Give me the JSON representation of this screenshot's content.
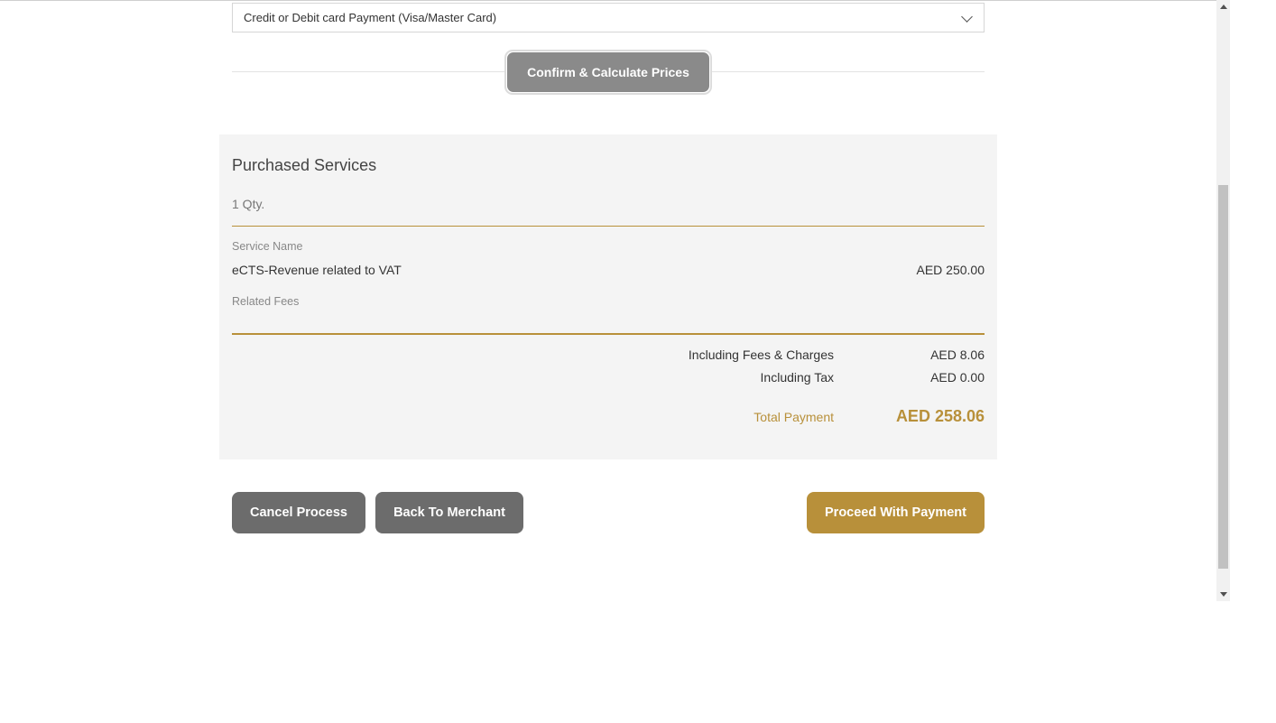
{
  "payment": {
    "selected_method": "Credit or Debit card Payment (Visa/Master Card)",
    "confirm_label": "Confirm & Calculate Prices"
  },
  "summary": {
    "title": "Purchased Services",
    "quantity": "1 Qty.",
    "service_name_label": "Service Name",
    "service_name": "eCTS-Revenue related to VAT",
    "service_amount": "AED 250.00",
    "related_fees_label": "Related Fees",
    "fees_label": "Including Fees & Charges",
    "fees_value": "AED 8.06",
    "tax_label": "Including Tax",
    "tax_value": "AED 0.00",
    "total_label": "Total Payment",
    "total_value": "AED 258.06"
  },
  "actions": {
    "cancel_label": "Cancel Process",
    "back_label": "Back To Merchant",
    "proceed_label": "Proceed With Payment"
  },
  "colors": {
    "accent_gold": "#b8903a",
    "button_gray": "#6c6c6c",
    "confirm_gray": "#8a8a8a",
    "panel_bg": "#f4f4f4"
  },
  "icons": {
    "select_chevron": "chevron-down-icon",
    "scroll_up": "scroll-up-arrow-icon",
    "scroll_down": "scroll-down-arrow-icon"
  }
}
